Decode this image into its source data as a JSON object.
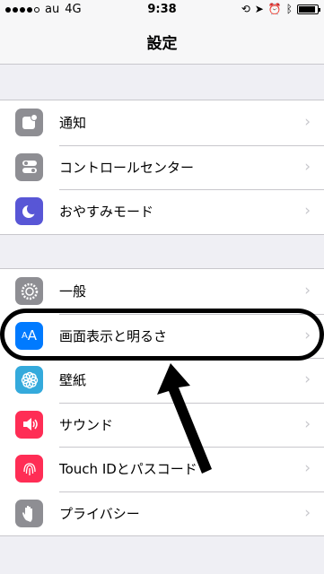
{
  "status": {
    "carrier": "au",
    "network": "4G",
    "time": "9:38"
  },
  "nav": {
    "title": "設定"
  },
  "group1": [
    {
      "label": "通知",
      "icon": "notifications-icon",
      "color": "#8e8e93"
    },
    {
      "label": "コントロールセンター",
      "icon": "control-center-icon",
      "color": "#8e8e93"
    },
    {
      "label": "おやすみモード",
      "icon": "moon-icon",
      "color": "#5856d6"
    }
  ],
  "group2": [
    {
      "label": "一般",
      "icon": "gear-icon",
      "color": "#8e8e93"
    },
    {
      "label": "画面表示と明るさ",
      "icon": "display-brightness-icon",
      "color": "#007aff"
    },
    {
      "label": "壁紙",
      "icon": "wallpaper-icon",
      "color": "#34aadc"
    },
    {
      "label": "サウンド",
      "icon": "speaker-icon",
      "color": "#ff2d55"
    },
    {
      "label": "Touch IDとパスコード",
      "icon": "fingerprint-icon",
      "color": "#ff2d55"
    },
    {
      "label": "プライバシー",
      "icon": "hand-icon",
      "color": "#8e8e93"
    }
  ]
}
